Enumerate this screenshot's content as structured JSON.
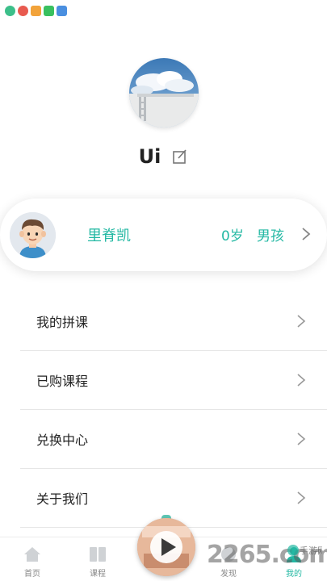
{
  "status_bar": {
    "icons": [
      {
        "name": "app-green-icon",
        "color": "#3cbf8a"
      },
      {
        "name": "app-red-icon",
        "color": "#e85a4f"
      },
      {
        "name": "app-orange-icon",
        "color": "#f2a33a"
      },
      {
        "name": "wechat-icon",
        "color": "#39c05f"
      },
      {
        "name": "shield-blue-icon",
        "color": "#4a8fe0"
      }
    ]
  },
  "profile": {
    "username": "Ui",
    "avatar_icon": "cloud-landscape-avatar",
    "edit_icon": "edit-icon"
  },
  "child_card": {
    "name": "里脊凯",
    "age": "0岁",
    "gender": "男孩",
    "avatar_icon": "boy-avatar"
  },
  "menu": {
    "items": [
      {
        "label": "我的拼课"
      },
      {
        "label": "已购课程"
      },
      {
        "label": "兑换中心"
      },
      {
        "label": "关于我们"
      }
    ]
  },
  "tab_bar": {
    "tabs": [
      {
        "label": "首页",
        "icon": "home-icon"
      },
      {
        "label": "课程",
        "icon": "book-icon"
      },
      {
        "label": "发现",
        "icon": "discover-icon"
      },
      {
        "label": "我的",
        "icon": "profile-icon",
        "active": true
      }
    ],
    "center_button_icon": "play-icon"
  },
  "watermark": {
    "text": "2265.com",
    "sub_text": "手游网"
  },
  "colors": {
    "accent": "#23b8a3",
    "text": "#222222",
    "divider": "#e6e6e6"
  }
}
